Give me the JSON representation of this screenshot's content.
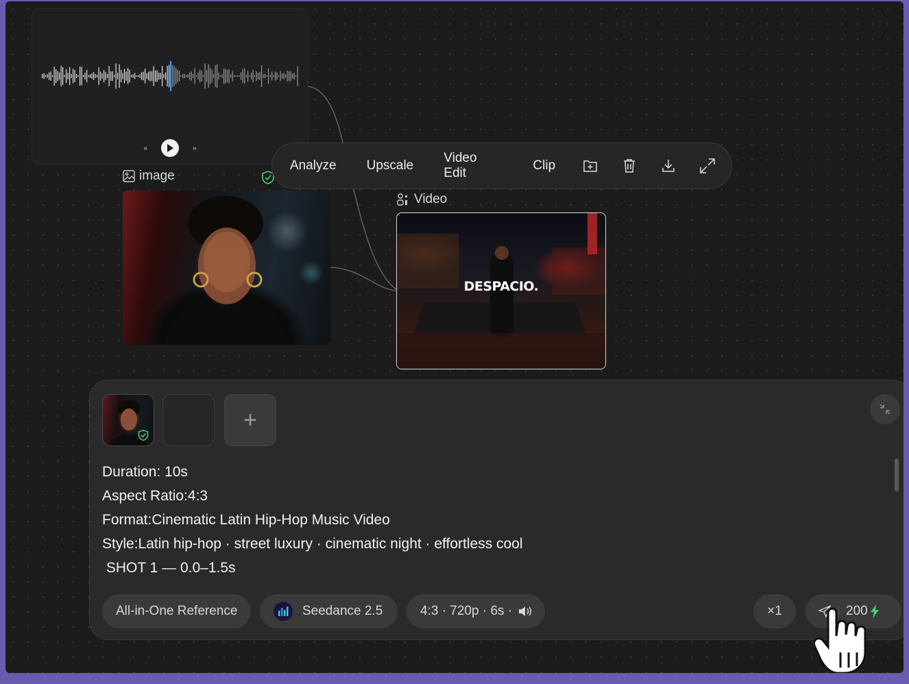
{
  "nodes": {
    "image_label": "image",
    "video_label": "Video",
    "video_overlay_title": "DESPACIO."
  },
  "toolbar": {
    "analyze": "Analyze",
    "upscale": "Upscale",
    "video_edit": "Video Edit",
    "clip": "Clip",
    "icons": [
      "add-frame-icon",
      "trash-icon",
      "download-icon",
      "fullscreen-icon"
    ]
  },
  "audio_player": {
    "icons": [
      "rewind-icon",
      "play-icon",
      "fast-forward-icon"
    ]
  },
  "prompt": {
    "lines": [
      "Duration: 10s",
      "Aspect Ratio:4:3",
      "Format:Cinematic Latin Hip-Hop Music Video",
      "Style:Latin hip-hop · street luxury · cinematic night · effortless cool",
      " SHOT 1 — 0.0–1.5s"
    ]
  },
  "controls": {
    "reference_mode": "All-in-One Reference",
    "model": "Seedance 2.5",
    "settings": "4:3 · 720p · 6s ·",
    "count": "×1",
    "credits": "200"
  },
  "colors": {
    "accent_green": "#3fd46b",
    "playhead_blue": "#3aa0ff",
    "canvas_bg": "#1c1c1c",
    "frame_purple": "#6a5bb0"
  }
}
